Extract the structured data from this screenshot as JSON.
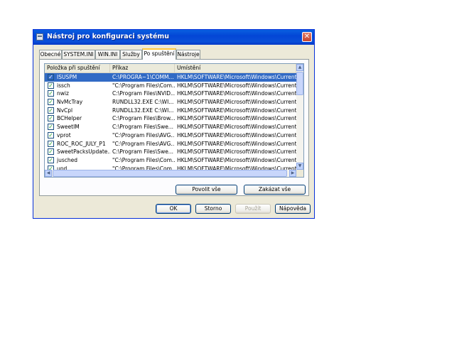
{
  "window": {
    "title": "Nástroj pro konfiguraci systému",
    "close_glyph": "✕",
    "icon": "msconfig-icon"
  },
  "tabs": [
    {
      "label": "Obecné",
      "active": false
    },
    {
      "label": "SYSTEM.INI",
      "active": false
    },
    {
      "label": "WIN.INI",
      "active": false
    },
    {
      "label": "Služby",
      "active": false
    },
    {
      "label": "Po spuštění",
      "active": true
    },
    {
      "label": "Nástroje",
      "active": false
    }
  ],
  "startup_list": {
    "columns": [
      "Položka při spuštění",
      "Příkaz",
      "Umístění"
    ],
    "rows": [
      {
        "checked": true,
        "selected": true,
        "name": "ISUSPM",
        "command": "C:\\PROGRA~1\\COMM...",
        "location": "HKLM\\SOFTWARE\\Microsoft\\Windows\\CurrentVer..."
      },
      {
        "checked": true,
        "selected": false,
        "name": "issch",
        "command": "\"C:\\Program Files\\Com...",
        "location": "HKLM\\SOFTWARE\\Microsoft\\Windows\\CurrentVer..."
      },
      {
        "checked": true,
        "selected": false,
        "name": "nwiz",
        "command": "C:\\Program Files\\NVID...",
        "location": "HKLM\\SOFTWARE\\Microsoft\\Windows\\CurrentVer..."
      },
      {
        "checked": true,
        "selected": false,
        "name": "NvMcTray",
        "command": "RUNDLL32.EXE C:\\WI...",
        "location": "HKLM\\SOFTWARE\\Microsoft\\Windows\\CurrentVer..."
      },
      {
        "checked": true,
        "selected": false,
        "name": "NvCpl",
        "command": "RUNDLL32.EXE C:\\WI...",
        "location": "HKLM\\SOFTWARE\\Microsoft\\Windows\\CurrentVer..."
      },
      {
        "checked": true,
        "selected": false,
        "name": "BCHelper",
        "command": "C:\\Program Files\\Brow...",
        "location": "HKLM\\SOFTWARE\\Microsoft\\Windows\\CurrentVer..."
      },
      {
        "checked": true,
        "selected": false,
        "name": "SweetIM",
        "command": "C:\\Program Files\\Swe...",
        "location": "HKLM\\SOFTWARE\\Microsoft\\Windows\\CurrentVer..."
      },
      {
        "checked": true,
        "selected": false,
        "name": "vprot",
        "command": "\"C:\\Program Files\\AVG...",
        "location": "HKLM\\SOFTWARE\\Microsoft\\Windows\\CurrentVer..."
      },
      {
        "checked": true,
        "selected": false,
        "name": "ROC_ROC_JULY_P1",
        "command": "\"C:\\Program Files\\AVG...",
        "location": "HKLM\\SOFTWARE\\Microsoft\\Windows\\CurrentVer..."
      },
      {
        "checked": true,
        "selected": false,
        "name": "SweetPacksUpdate...",
        "command": "C:\\Program Files\\Swe...",
        "location": "HKLM\\SOFTWARE\\Microsoft\\Windows\\CurrentVer..."
      },
      {
        "checked": true,
        "selected": false,
        "name": "jusched",
        "command": "\"C:\\Program Files\\Com...",
        "location": "HKLM\\SOFTWARE\\Microsoft\\Windows\\CurrentVer..."
      },
      {
        "checked": true,
        "selected": false,
        "name": "upd",
        "command": "\"C:\\Program Files\\Com...",
        "location": "HKLM\\SOFTWARE\\Microsoft\\Windows\\CurrentVer..."
      }
    ]
  },
  "panel_buttons": {
    "enable_all": "Povolit vše",
    "disable_all": "Zakázat vše"
  },
  "dialog_buttons": {
    "ok": "OK",
    "cancel": "Storno",
    "apply": "Použít",
    "help": "Nápověda"
  },
  "scroll_glyphs": {
    "up": "▲",
    "down": "▼",
    "left": "◀",
    "right": "▶"
  },
  "colors": {
    "titlebar": "#0346d6",
    "selection": "#316ac5",
    "active_tab_accent": "#ffc83c",
    "dialog_bg": "#ece9d8"
  }
}
